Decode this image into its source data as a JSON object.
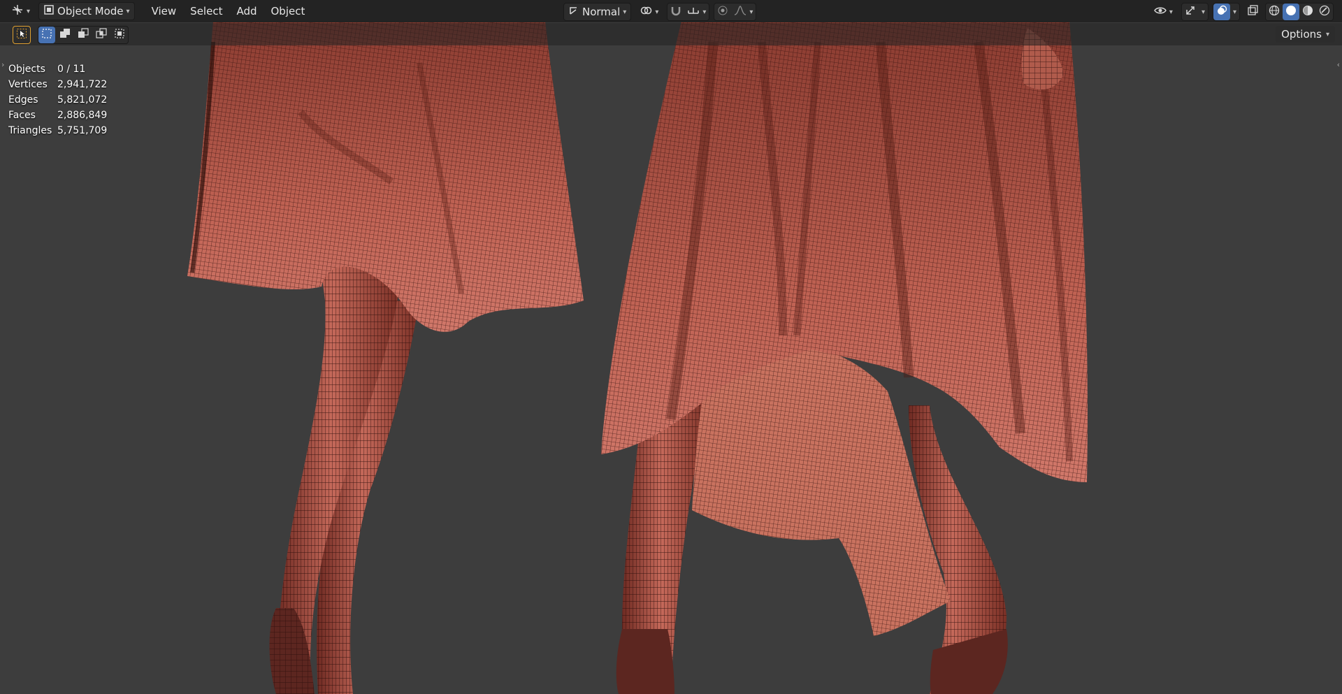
{
  "header": {
    "editor_type_icon": "view3d-editor-icon",
    "mode_icon": "object-mode-icon",
    "mode_label": "Object Mode",
    "menus": [
      "View",
      "Select",
      "Add",
      "Object"
    ],
    "orientation_icon": "transform-orientation-icon",
    "orientation_label": "Normal",
    "pivot_icon": "pivot-point-icon",
    "snap_icon": "snap-magnet-icon",
    "snap_target_icon": "snap-increment-icon",
    "proportional_icon": "proportional-edit-icon",
    "falloff_icon": "falloff-curve-icon",
    "visibility_icon": "object-visibility-eye-icon",
    "gizmo_icon": "gizmo-arrows-icon",
    "overlay_icon": "overlays-icon",
    "xray_icon": "xray-toggle-icon",
    "shading_modes": [
      "wireframe-shading-icon",
      "solid-shading-icon",
      "material-preview-icon",
      "rendered-shading-icon"
    ],
    "active_shading": "solid-shading-icon"
  },
  "toolbar": {
    "select_tool_icon": "select-box-tool-icon",
    "select_modes": [
      "select-new-icon",
      "select-extend-icon",
      "select-subtract-icon",
      "select-intersect-icon"
    ],
    "options_label": "Options"
  },
  "stats": [
    {
      "label": "Objects",
      "value": "0 / 11"
    },
    {
      "label": "Vertices",
      "value": "2,941,722"
    },
    {
      "label": "Edges",
      "value": "5,821,072"
    },
    {
      "label": "Faces",
      "value": "2,886,849"
    },
    {
      "label": "Triangles",
      "value": "5,751,709"
    }
  ],
  "colors": {
    "viewport_bg": "#3d3d3d",
    "header_bg": "#232323",
    "accent": "#4772b3",
    "mesh_base": "#b8594c",
    "wire": "#2a0d0a"
  }
}
